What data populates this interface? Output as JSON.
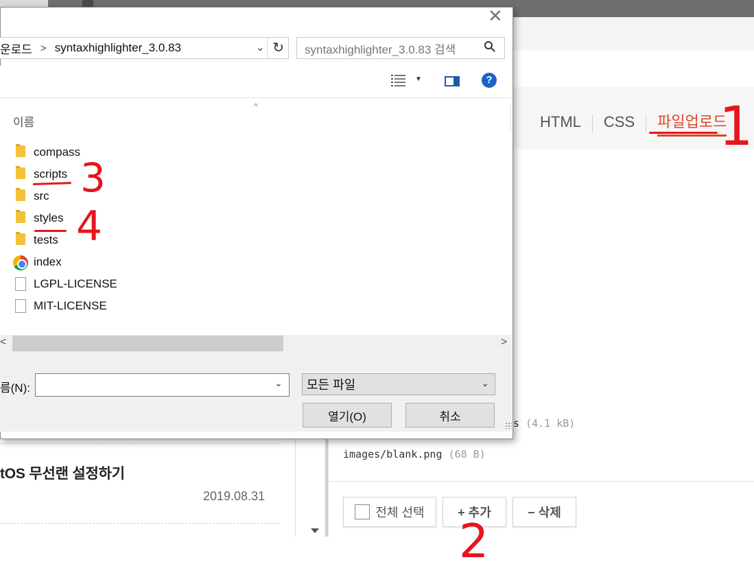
{
  "background_page": {
    "editor_tabs": [
      {
        "label": "HTML",
        "active": false
      },
      {
        "label": "CSS",
        "active": false
      },
      {
        "label": "파일업로드",
        "active": true
      }
    ],
    "accent_color": "#e0452a",
    "uploaded_files": [
      {
        "name": "s",
        "size": "(4.1 kB)"
      },
      {
        "name": "images/blank.png",
        "size": "(68 B)"
      }
    ],
    "buttons": {
      "select_all": "전체 선택",
      "add": "+ 추가",
      "delete": "− 삭제"
    },
    "sidebar_post": {
      "title": "tOS 무선랜 설정하기",
      "date": "2019.08.31"
    }
  },
  "dialog": {
    "close_label": "✕",
    "breadcrumb": {
      "parent_segment": "운로드",
      "current_folder": "syntaxhighlighter_3.0.83"
    },
    "search_placeholder": "syntaxhighlighter_3.0.83 검색",
    "column_header": "이름",
    "items": [
      {
        "name": "compass",
        "icon": "folder-icon"
      },
      {
        "name": "scripts",
        "icon": "folder-icon"
      },
      {
        "name": "src",
        "icon": "folder-icon"
      },
      {
        "name": "styles",
        "icon": "folder-icon"
      },
      {
        "name": "tests",
        "icon": "folder-icon"
      },
      {
        "name": "index",
        "icon": "chrome-file-icon"
      },
      {
        "name": "LGPL-LICENSE",
        "icon": "document-icon"
      },
      {
        "name": "MIT-LICENSE",
        "icon": "document-icon"
      }
    ],
    "filename_label": "름(N):",
    "filename_value": "",
    "filetype_selected": "모든 파일",
    "open_button": "열기(O)",
    "cancel_button": "취소",
    "help_label": "?"
  },
  "annotations": {
    "color": "#e8141c",
    "marks": [
      "1",
      "2",
      "3",
      "4"
    ]
  }
}
